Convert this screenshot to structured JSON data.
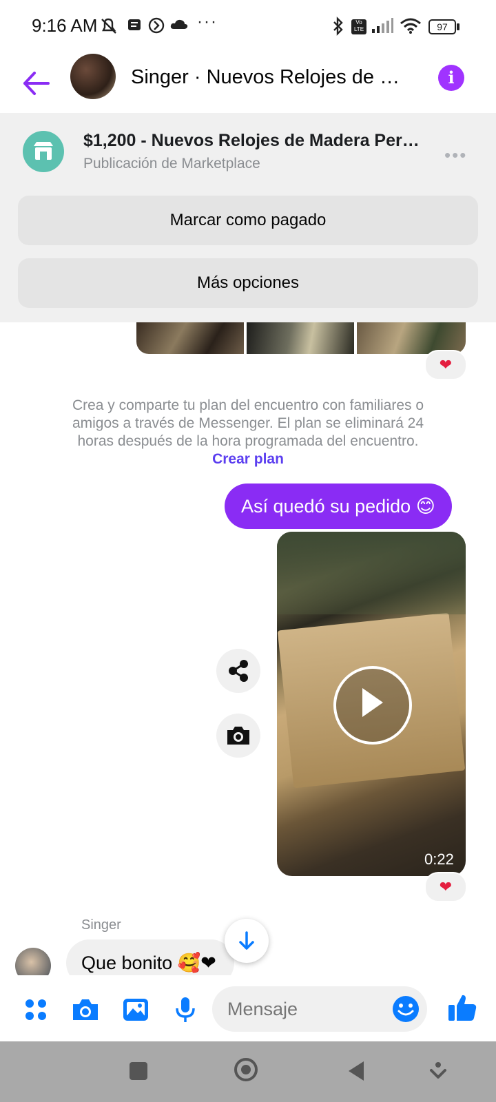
{
  "status_bar": {
    "time": "9:16 AM",
    "battery": "97",
    "icons": [
      "notification-muted-icon",
      "message-icon",
      "sync-icon",
      "cloud-icon",
      "more-dots-icon",
      "bluetooth-icon",
      "volte-icon",
      "signal-icon",
      "wifi-icon",
      "battery-icon"
    ],
    "volte": "Vo LTE"
  },
  "header": {
    "title": "Singer · Nuevos Relojes de Madera Personalizados"
  },
  "marketplace": {
    "title": "$1,200 - Nuevos Relojes de Madera Personalizados",
    "subtitle": "Publicación de Marketplace",
    "more": "•••",
    "mark_paid_label": "Marcar como pagado",
    "more_options_label": "Más opciones"
  },
  "conversation": {
    "reaction_1": "❤",
    "plan_text": "Crea y comparte tu plan del encuentro con familiares o amigos a través de Messenger. El plan se eliminará 24 horas después de la hora programada del encuentro.",
    "plan_link": "Crear plan",
    "outgoing_message": "Así quedó su pedido 😊",
    "video_duration": "0:22",
    "reaction_2": "❤",
    "sender_name": "Singer",
    "incoming_message": "Que bonito 🥰❤"
  },
  "composer": {
    "placeholder": "Mensaje"
  },
  "colors": {
    "accent_purple": "#8a2cf4",
    "link_blue": "#5b3ef0",
    "icon_blue": "#0a7cff",
    "marketplace_teal": "#5cc1b0"
  }
}
